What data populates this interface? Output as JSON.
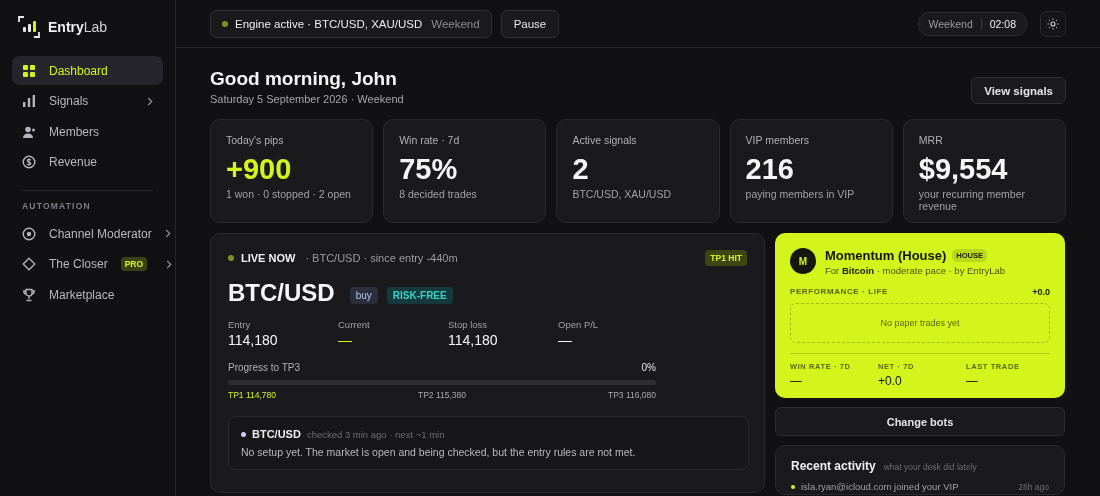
{
  "brand": {
    "name_bold": "Entry",
    "name_light": "Lab"
  },
  "sidebar": {
    "items": [
      {
        "label": "Dashboard",
        "kind": "grid",
        "selected": true,
        "chevron": false
      },
      {
        "label": "Signals",
        "kind": "bars",
        "selected": false,
        "chevron": true
      },
      {
        "label": "Members",
        "kind": "person",
        "selected": false,
        "chevron": false
      },
      {
        "label": "Revenue",
        "kind": "coin",
        "selected": false,
        "chevron": false
      }
    ],
    "section_label": "AUTOMATION",
    "automation_items": [
      {
        "label": "Channel Moderator",
        "kind": "target",
        "selected": false,
        "chevron": true
      },
      {
        "label": "The Closer",
        "kind": "diamond",
        "selected": false,
        "chevron": true,
        "badge": "PRO"
      },
      {
        "label": "Marketplace",
        "kind": "trophy",
        "selected": false,
        "chevron": false
      }
    ]
  },
  "topbar": {
    "engine": {
      "text": "Engine active · BTC/USD, XAU/USD",
      "tag": "Weekend",
      "on": true
    },
    "pause_button": "Pause",
    "session": "Weekend",
    "clock": "02:08"
  },
  "header": {
    "greeting": "Good morning, John",
    "date": "Saturday 5 September 2026 · Weekend",
    "action": "View signals"
  },
  "stats": [
    {
      "label": "Today's pips",
      "value": "+900",
      "note": "1 won · 0 stopped · 2 open",
      "highlight": true
    },
    {
      "label": "Win rate · 7d",
      "value": "75%",
      "note": "8 decided trades",
      "highlight": false
    },
    {
      "label": "Active signals",
      "value": "2",
      "note": "BTC/USD, XAU/USD",
      "highlight": false
    },
    {
      "label": "VIP members",
      "value": "216",
      "note": "paying members in VIP",
      "highlight": false
    },
    {
      "label": "MRR",
      "value": "$9,554",
      "note": "your recurring member revenue",
      "highlight": false
    }
  ],
  "live": {
    "status": "LIVE NOW",
    "meta": "· BTC/USD · since entry -440m",
    "tp_badge": "TP1 HIT",
    "pair": "BTC/USD",
    "side": "buy",
    "tag": "RISK-FREE",
    "figures": [
      {
        "label": "Entry",
        "value": "114,180",
        "highlight": false
      },
      {
        "label": "Current",
        "value": "—",
        "highlight": true
      },
      {
        "label": "Stop loss",
        "value": "114,180",
        "highlight": false
      },
      {
        "label": "Open P/L",
        "value": "—",
        "highlight": false
      }
    ],
    "progress": {
      "label": "Progress to TP3",
      "reading": "0%",
      "level": 0
    },
    "targets": [
      {
        "text": "TP1 114,780",
        "hit": true
      },
      {
        "text": "TP2 115,380",
        "hit": false
      },
      {
        "text": "TP3 116,080",
        "hit": false
      }
    ],
    "check": {
      "pair": "BTC/USD",
      "meta": "checked 3 min ago · next ~1 min",
      "message": "No setup yet. The market is open and being checked, but the entry rules are not met."
    }
  },
  "bot": {
    "avatar": "M",
    "name": "Momentum (House)",
    "badge": "HOUSE",
    "subtitle": "For **Bitcoin** · moderate pace · by EntryLab",
    "performance_label": "PERFORMANCE · LIFE",
    "performance_value": "+0.0",
    "empty": "No paper trades yet",
    "metrics": [
      {
        "label": "WIN RATE · 7D",
        "value": "—"
      },
      {
        "label": "NET · 7D",
        "value": "+0.0"
      },
      {
        "label": "LAST TRADE",
        "value": "—"
      }
    ]
  },
  "change_bots": "Change bots",
  "activity": {
    "title": "Recent activity",
    "subtitle": "what your desk did lately",
    "items": [
      {
        "text": "isla.ryan@icloud.com joined your VIP",
        "time": "28h ago"
      }
    ]
  }
}
